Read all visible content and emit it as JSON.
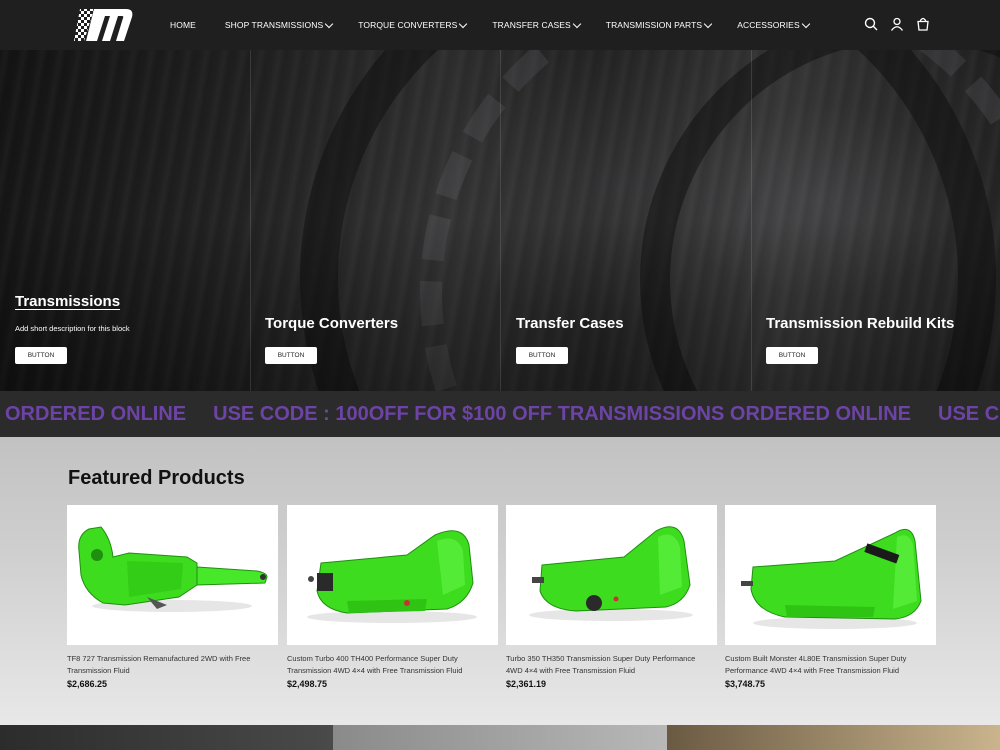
{
  "nav": {
    "items": [
      {
        "label": "HOME",
        "dropdown": false
      },
      {
        "label": "SHOP TRANSMISSIONS",
        "dropdown": true
      },
      {
        "label": "TORQUE CONVERTERS",
        "dropdown": true
      },
      {
        "label": "TRANSFER CASES",
        "dropdown": true
      },
      {
        "label": "TRANSMISSION PARTS",
        "dropdown": true
      },
      {
        "label": "ACCESSORIES",
        "dropdown": true
      }
    ],
    "icons": [
      "search-icon",
      "account-icon",
      "cart-icon"
    ]
  },
  "hero": {
    "blocks": [
      {
        "title": "Transmissions",
        "description": "Add short description for this block",
        "button": "BUTTON"
      },
      {
        "title": "Torque Converters",
        "button": "BUTTON"
      },
      {
        "title": "Transfer Cases",
        "button": "BUTTON"
      },
      {
        "title": "Transmission Rebuild Kits",
        "button": "BUTTON"
      }
    ]
  },
  "marquee": {
    "fragments": [
      "ORDERED ONLINE",
      "USE CODE : 100OFF FOR $100 OFF TRANSMISSIONS ORDERED ONLINE",
      "USE CODE"
    ],
    "color": "#6d44a6"
  },
  "featured": {
    "title": "Featured Products",
    "products": [
      {
        "title": "TF8 727 Transmission Remanufactured 2WD with Free Transmission Fluid",
        "price": "$2,686.25"
      },
      {
        "title": "Custom Turbo 400 TH400 Performance Super Duty Transmission 4WD 4×4 with Free Transmission Fluid",
        "price": "$2,498.75"
      },
      {
        "title": "Turbo 350 TH350 Transmission Super Duty Performance 4WD 4×4 with Free Transmission Fluid",
        "price": "$2,361.19"
      },
      {
        "title": "Custom Built Monster 4L80E Transmission Super Duty Performance 4WD 4×4 with Free Transmission Fluid",
        "price": "$3,748.75"
      }
    ],
    "product_color": "#3ddc1f"
  }
}
